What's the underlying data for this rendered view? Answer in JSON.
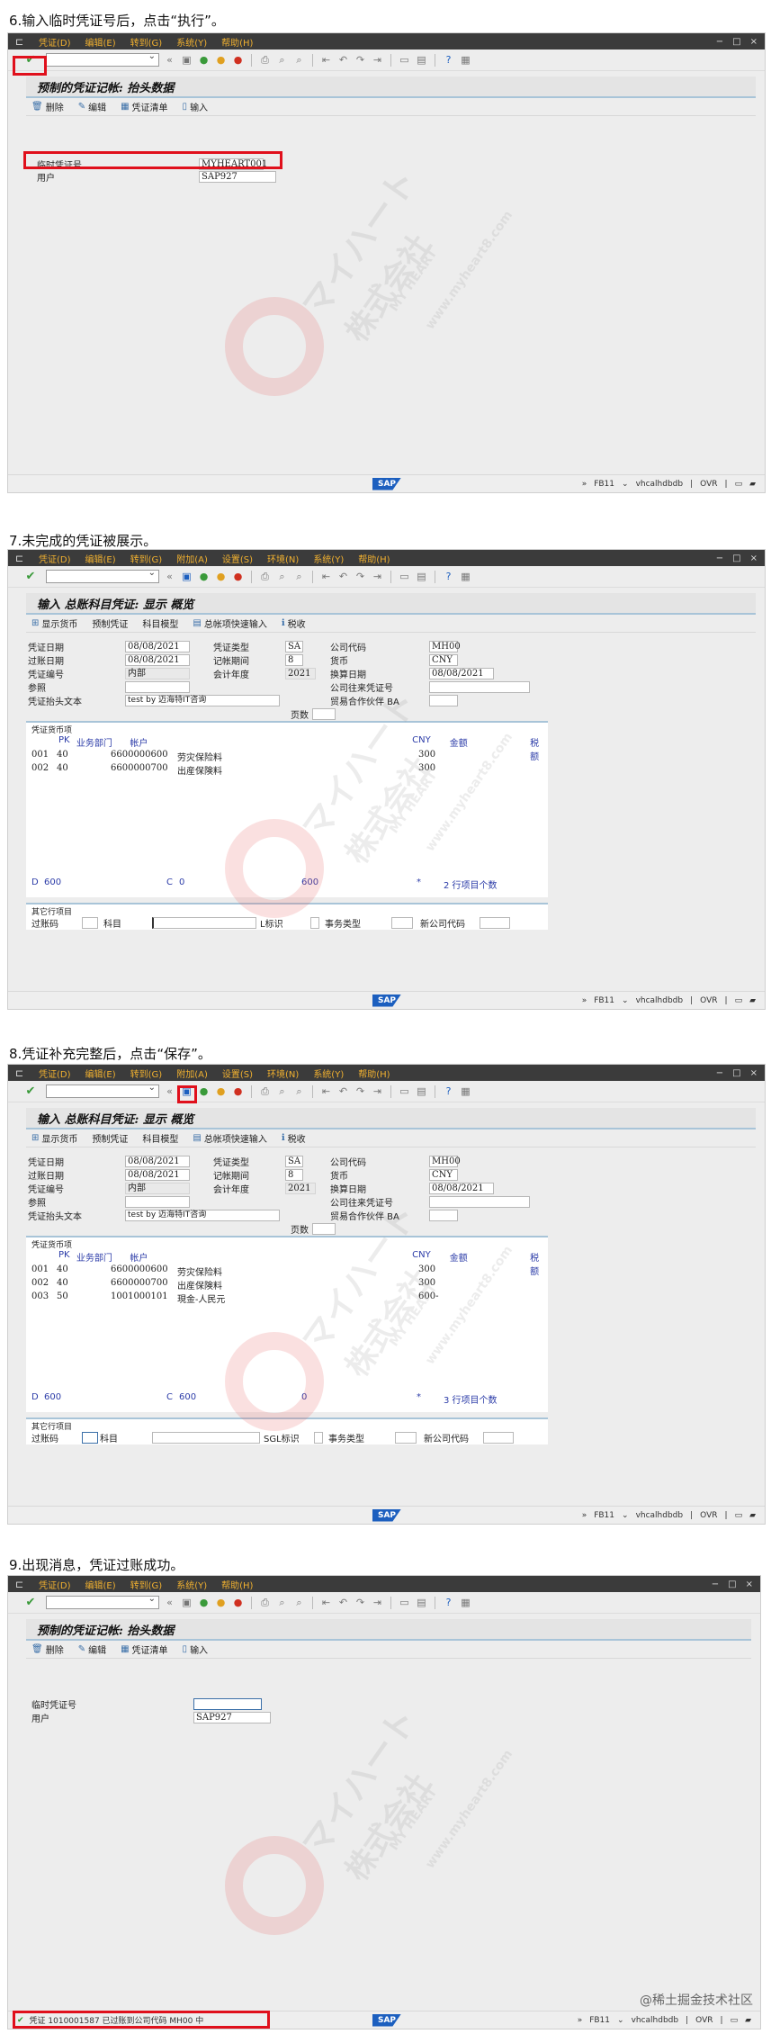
{
  "steps": [
    {
      "label": "6.输入临时凭证号后，点击“执行”。"
    },
    {
      "label": "7.未完成的凭证被展示。"
    },
    {
      "label": "8.凭证补充完整后，点击“保存”。"
    },
    {
      "label": "9.出现消息，凭证过账成功。"
    }
  ],
  "menu_a": [
    "凭证(D)",
    "编辑(E)",
    "转到(G)",
    "系统(Y)",
    "帮助(H)"
  ],
  "menu_b": [
    "凭证(D)",
    "编辑(E)",
    "转到(G)",
    "附加(A)",
    "设置(S)",
    "环境(N)",
    "系统(Y)",
    "帮助(H)"
  ],
  "screen1": {
    "title": "预制的凭证记帐: 抬头数据",
    "buttons": [
      "删除",
      "编辑",
      "凭证清单",
      "输入"
    ],
    "temp_doc_label": "临时凭证号",
    "temp_doc_value": "MYHEART001",
    "user_label": "用户",
    "user_value": "SAP927"
  },
  "overview": {
    "title": "输入 总账科目凭证: 显示 概览",
    "buttons": [
      "显示货币",
      "预制凭证",
      "科目模型",
      "总帐项快速输入",
      "税收"
    ],
    "doc_date_label": "凭证日期",
    "doc_date": "08/08/2021",
    "doc_type_label": "凭证类型",
    "doc_type": "SA",
    "company_label": "公司代码",
    "company": "MH00",
    "post_date_label": "过账日期",
    "post_date": "08/08/2021",
    "period_label": "记帐期间",
    "period": "8",
    "currency_label": "货币",
    "currency": "CNY",
    "doc_no_label": "凭证编号",
    "doc_no": "内部",
    "fiscal_year_label": "会计年度",
    "fiscal_year": "2021",
    "trans_date_label": "换算日期",
    "trans_date": "08/08/2021",
    "ref_label": "参照",
    "intercompany_label": "公司往来凭证号",
    "header_text_label": "凭证抬头文本",
    "header_text": "test by 迈海特IT咨询",
    "partner_label": "贸易合作伙伴 BA",
    "page_label": "页数",
    "items_section": "凭证货币项",
    "col_pk": "PK",
    "col_bs": "业务部门",
    "col_acct": "帐户",
    "col_cny": "CNY",
    "col_amount": "金额",
    "col_tax": "税额",
    "other_section": "其它行项目",
    "other_post_key": "过账码",
    "other_account": "科目",
    "other_sgl": "SGL标识",
    "other_trans_type": "事务类型",
    "other_new_company": "新公司代码"
  },
  "screen2": {
    "rows": [
      {
        "no": "001",
        "pk": "40",
        "acct": "6600000600",
        "name": "劳灾保险料",
        "amount": "300"
      },
      {
        "no": "002",
        "pk": "40",
        "acct": "6600000700",
        "name": "出産保険料",
        "amount": "300"
      }
    ],
    "debit_label": "D",
    "debit": "600",
    "credit_label": "C",
    "credit": "0",
    "balance": "600",
    "star": "*",
    "items_count": "2 行项目个数",
    "sgl_short": "L标识"
  },
  "screen3": {
    "rows": [
      {
        "no": "001",
        "pk": "40",
        "acct": "6600000600",
        "name": "劳灾保险料",
        "amount": "300"
      },
      {
        "no": "002",
        "pk": "40",
        "acct": "6600000700",
        "name": "出産保険料",
        "amount": "300"
      },
      {
        "no": "003",
        "pk": "50",
        "acct": "1001000101",
        "name": "現金-人民元",
        "amount": "600-"
      }
    ],
    "debit_label": "D",
    "debit": "600",
    "credit_label": "C",
    "credit": "600",
    "balance": "0",
    "star": "*",
    "items_count": "3 行项目个数"
  },
  "screen4": {
    "title": "预制的凭证记帐: 抬头数据",
    "buttons": [
      "删除",
      "编辑",
      "凭证清单",
      "输入"
    ],
    "temp_doc_label": "临时凭证号",
    "user_label": "用户",
    "user_value": "SAP927",
    "message": "凭证 1010001587 已过账到公司代码 MH00 中"
  },
  "status": {
    "sap_logo": "SAP",
    "tx1": "FB11",
    "host1": "vhcalhdbdb",
    "mode": "OVR",
    "host2": "vhcalhdbdb"
  },
  "watermark": {
    "katakana": "マイハート",
    "kanji": "株式会社",
    "latin": "MY HEART",
    "url": "www.myheart8.com"
  },
  "footer_mark": "@稀土掘金技术社区",
  "colors": {
    "menu_bg": "#3b3b3b",
    "menu_text": "#f0b030",
    "highlight": "#e0101c",
    "accent_blue": "#2c3ca8"
  }
}
